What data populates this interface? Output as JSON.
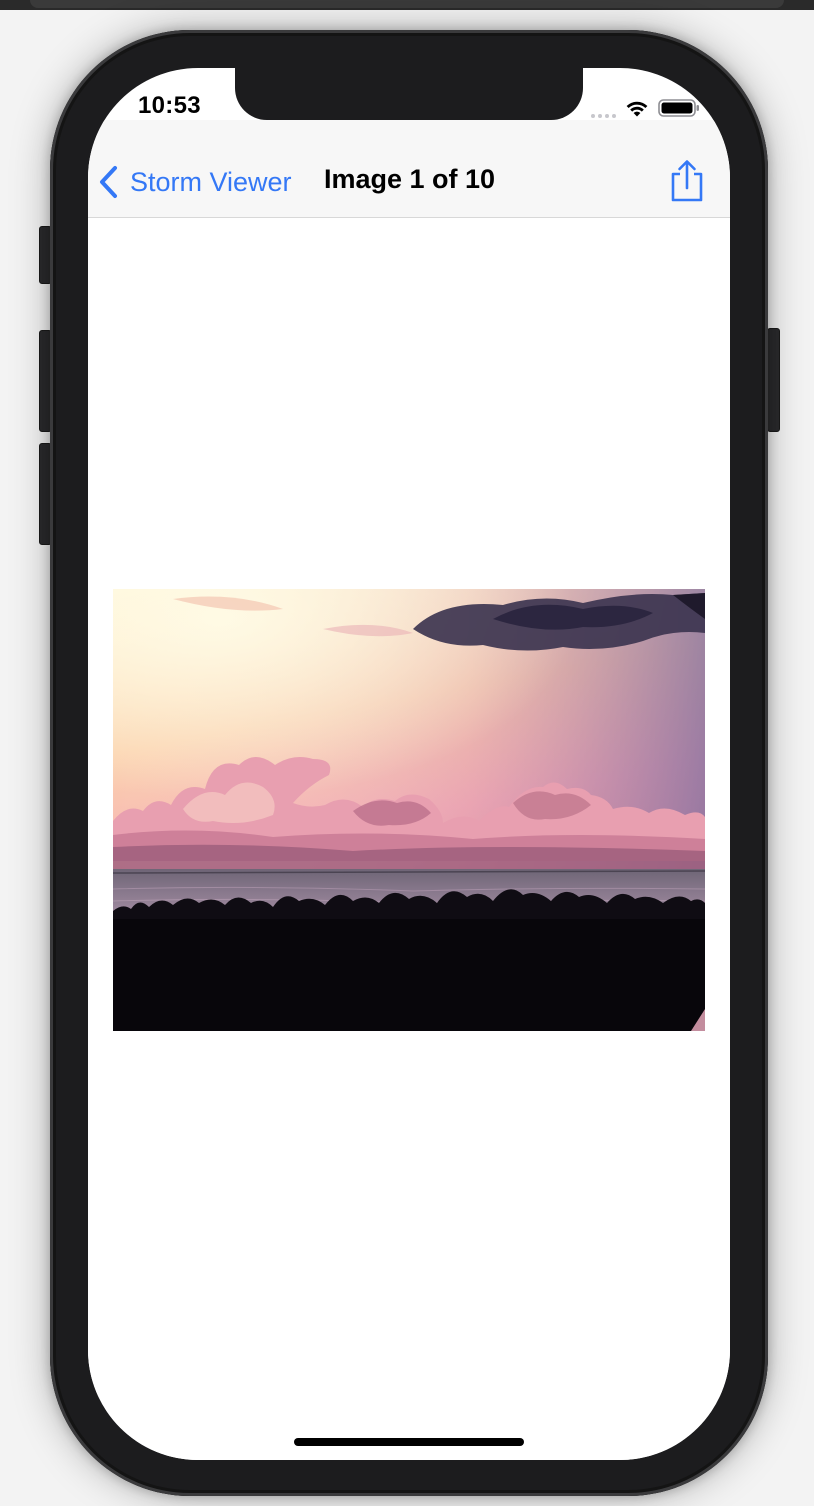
{
  "status_bar": {
    "time": "10:53",
    "wifi_icon": "wifi-icon",
    "battery_icon": "battery-icon"
  },
  "nav_bar": {
    "back_label": "Storm Viewer",
    "back_icon": "chevron-left-icon",
    "title": "Image 1 of 10",
    "share_icon": "share-icon"
  },
  "content": {
    "photo_subject": "sunset over ocean with clouds"
  },
  "colors": {
    "accent": "#3478f6",
    "nav_background": "#f7f7f7",
    "device_frame": "#1c1c1e"
  }
}
